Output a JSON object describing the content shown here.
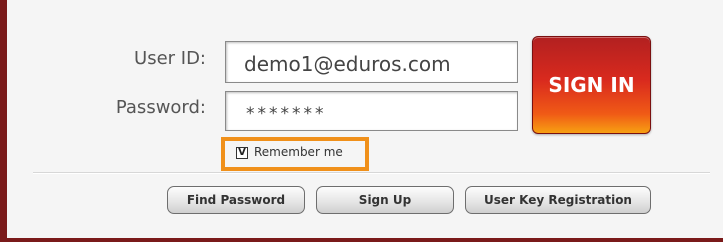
{
  "login": {
    "user_id_label": "User ID:",
    "user_id_value": "demo1@eduros.com",
    "password_label": "Password:",
    "password_value": "*******",
    "sign_in_label": "SIGN IN",
    "remember_checked": "V",
    "remember_label": "Remember me"
  },
  "actions": {
    "find_password": "Find Password",
    "sign_up": "Sign Up",
    "user_key_registration": "User Key Registration"
  },
  "colors": {
    "accent_dark_red": "#7a1a1a",
    "signin_gradient_top": "#b22020",
    "signin_gradient_bottom": "#f7a012",
    "highlight_orange": "#f0901a"
  }
}
